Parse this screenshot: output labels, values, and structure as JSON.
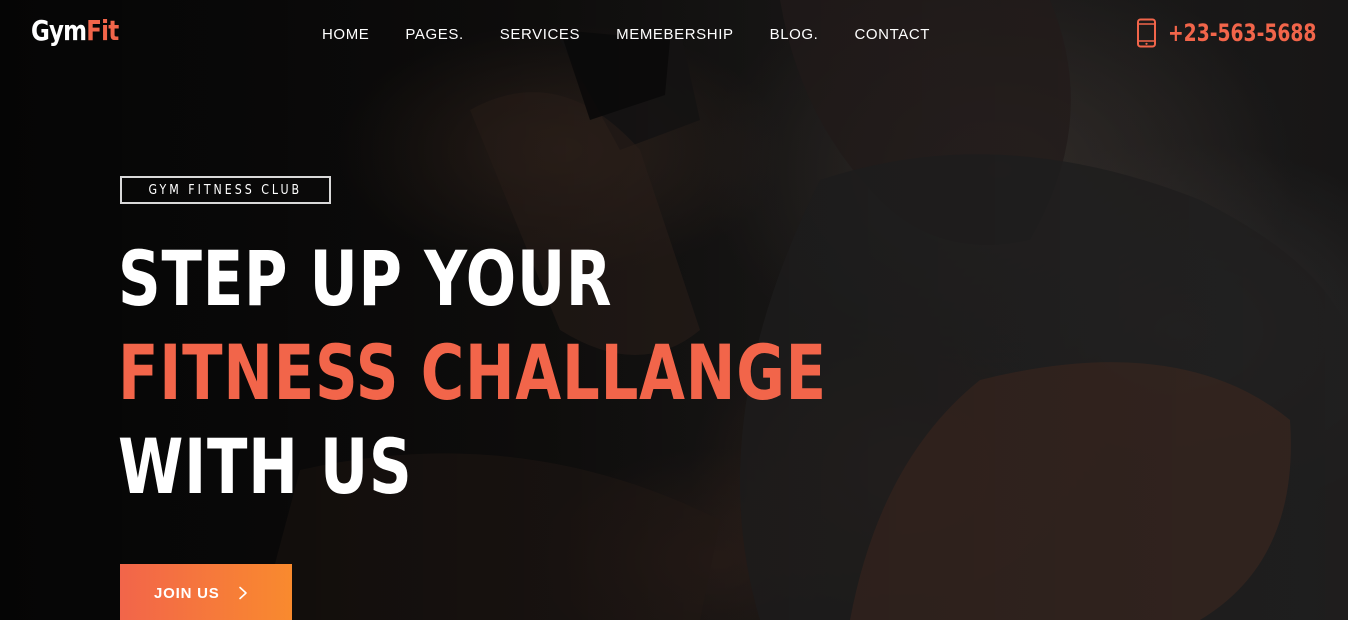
{
  "brand": {
    "logo_part1": "Gym",
    "logo_part2": "Fit",
    "accent_color": "#f2654a"
  },
  "nav": {
    "items": [
      {
        "label": "HOME"
      },
      {
        "label": "PAGES."
      },
      {
        "label": "SERVICES"
      },
      {
        "label": "MEMEBERSHIP"
      },
      {
        "label": "BLOG."
      },
      {
        "label": "CONTACT"
      }
    ]
  },
  "contact": {
    "phone": "+23-563-5688",
    "icon": "phone-icon"
  },
  "hero": {
    "tag": "GYM FITNESS CLUB",
    "headline_line1": "STEP UP YOUR",
    "headline_line2": "FITNESS CHALLANGE",
    "headline_line3": "WITH US",
    "cta_label": "JOIN US",
    "cta_icon": "chevron-right-icon",
    "background": "gym-athlete-photo"
  }
}
